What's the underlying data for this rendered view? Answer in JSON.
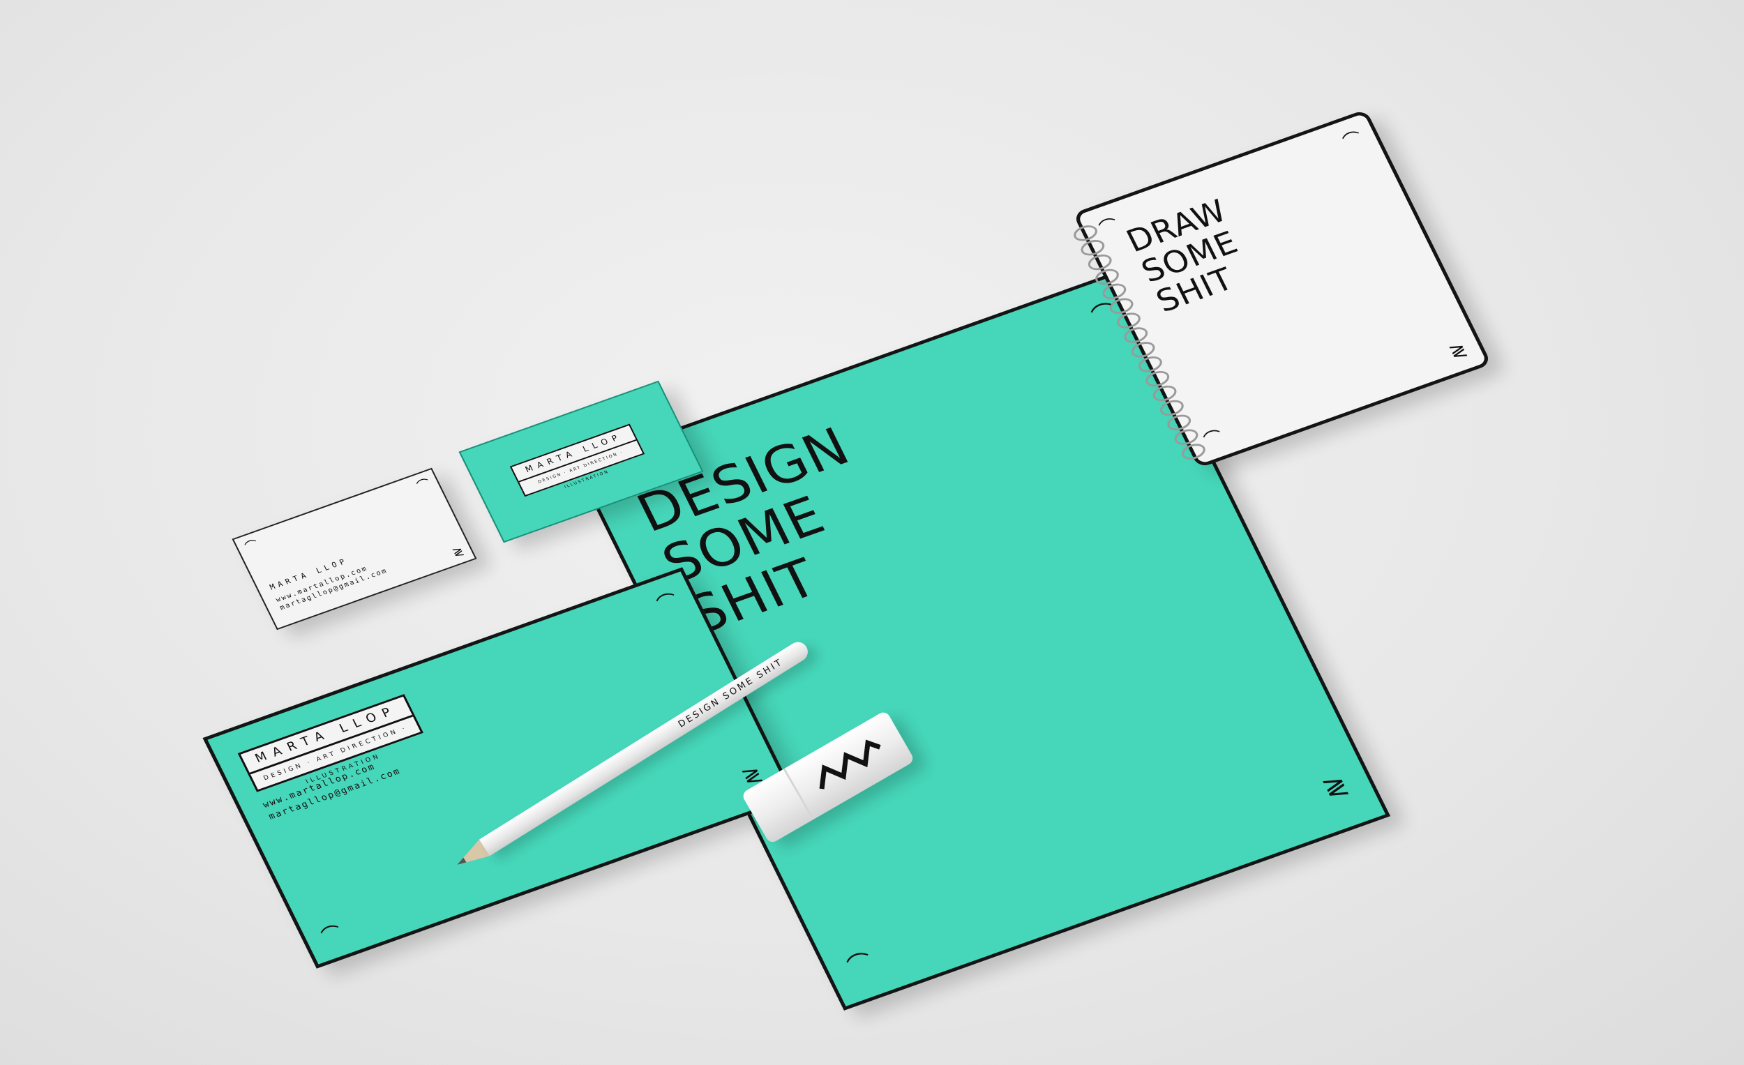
{
  "colors": {
    "background": "#e9e9e9",
    "mint": "#46d6b9",
    "paper": "#f4f4f4",
    "ink": "#111111"
  },
  "poster": {
    "headline": [
      "DESIGN",
      "SOME",
      "SHIT"
    ]
  },
  "notebook": {
    "headline": [
      "DRAW",
      "SOME",
      "SHIT"
    ]
  },
  "card_white": {
    "name": "MARTA LLOP",
    "website": "www.martallop.com",
    "email": "martagllop@gmail.com"
  },
  "card_mint": {
    "name": "MARTA LLOP",
    "roles": "DESIGN · ART DIRECTION · ILLUSTRATION"
  },
  "envelope": {
    "name": "MARTA LLOP",
    "roles": "DESIGN · ART DIRECTION · ILLUSTRATION",
    "website": "www.martallop.com",
    "email": "martagllop@gmail.com"
  },
  "pencil": {
    "text": "DESIGN SOME SHIT"
  },
  "eraser": {
    "icon": "zigzag-icon"
  },
  "icons": {
    "corner": "corner-tick-icon",
    "squiggle": "squiggle-icon"
  }
}
